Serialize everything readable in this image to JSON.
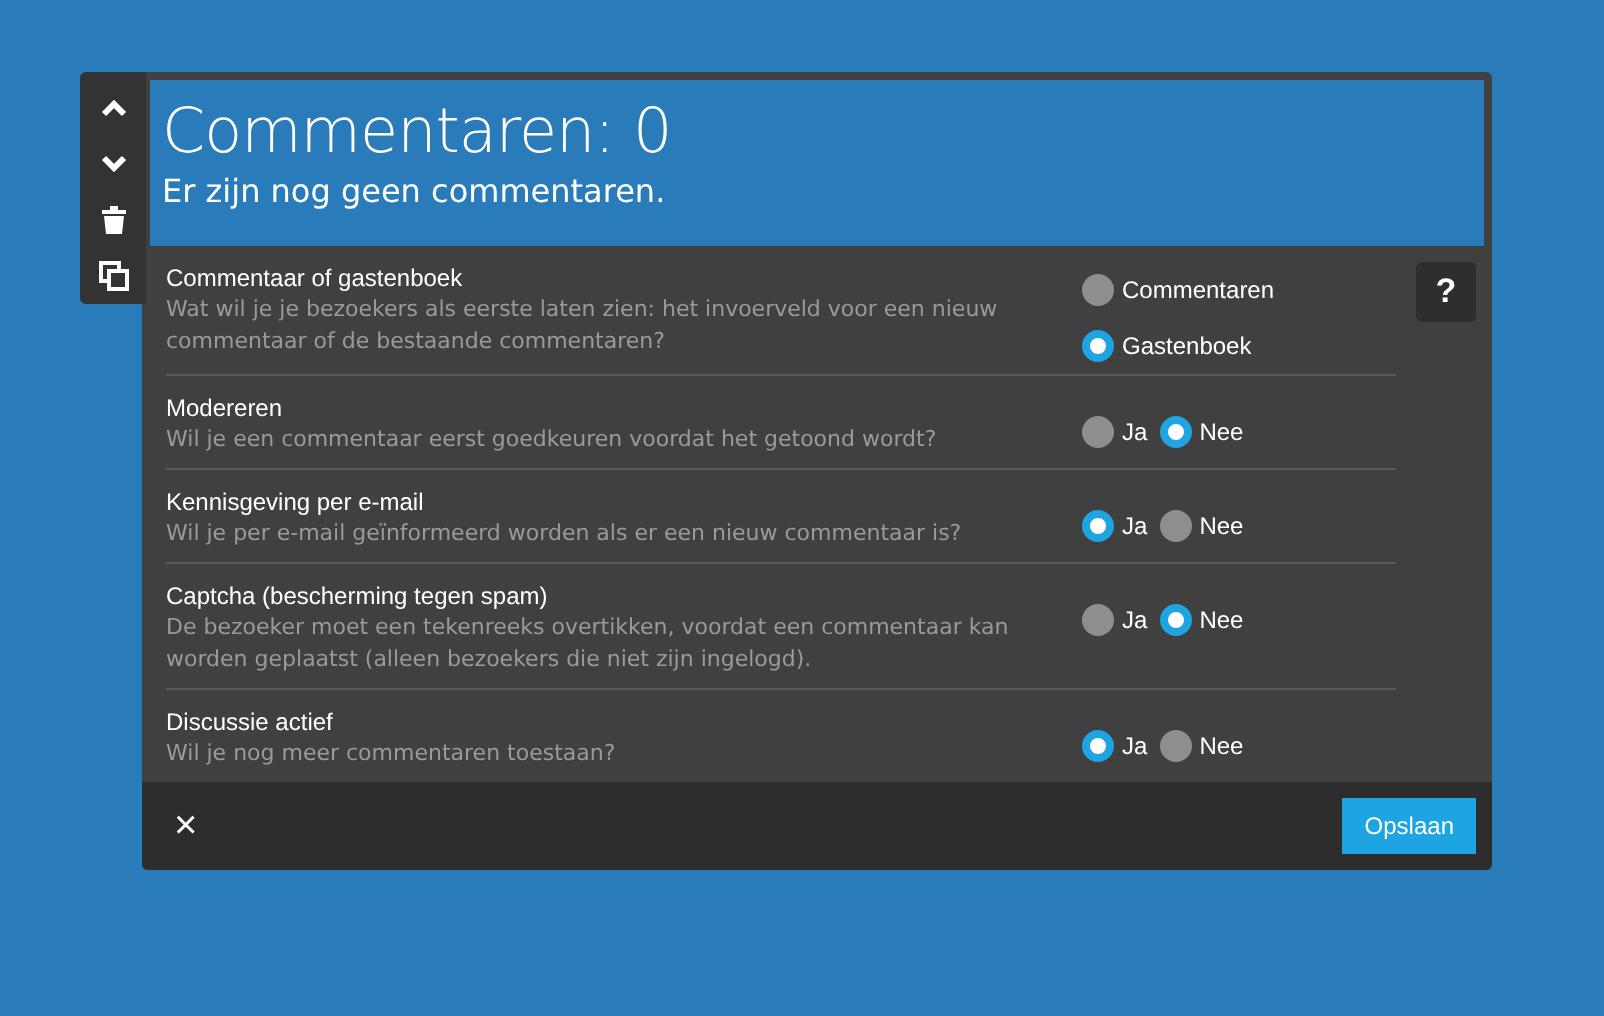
{
  "toolbar": {
    "buttons": [
      {
        "kind": "up"
      },
      {
        "kind": "down"
      },
      {
        "kind": "delete"
      },
      {
        "kind": "copy"
      }
    ]
  },
  "header": {
    "title": "Commentaren: 0",
    "subtitle": "Er zijn nog geen commentaren."
  },
  "help_button": "?",
  "settings": [
    {
      "title": "Commentaar of gastenboek",
      "description": "Wat wil je je bezoekers als eerste laten zien: het invoerveld voor een nieuw commentaar of de bestaande commentaren?",
      "kind": "stacked",
      "options": [
        {
          "label": "Commentaren",
          "selected": false
        },
        {
          "label": "Gastenboek",
          "selected": true
        }
      ]
    },
    {
      "title": "Modereren",
      "description": "Wil je een commentaar eerst goedkeuren voordat het getoond wordt?",
      "kind": "inline",
      "options": [
        {
          "label": "Ja",
          "selected": false
        },
        {
          "label": "Nee",
          "selected": true
        }
      ]
    },
    {
      "title": "Kennisgeving per e-mail",
      "description": "Wil je per e-mail geïnformeerd worden als er een nieuw commentaar is?",
      "kind": "inline",
      "options": [
        {
          "label": "Ja",
          "selected": true
        },
        {
          "label": "Nee",
          "selected": false
        }
      ]
    },
    {
      "title": "Captcha (bescherming tegen spam)",
      "description": "De bezoeker moet een tekenreeks overtikken, voordat een commentaar kan worden geplaatst (alleen bezoekers die niet zijn ingelogd).",
      "kind": "inline",
      "options": [
        {
          "label": "Ja",
          "selected": false
        },
        {
          "label": "Nee",
          "selected": true
        }
      ]
    },
    {
      "title": "Discussie actief",
      "description": "Wil je nog meer commentaren toestaan?",
      "kind": "inline",
      "options": [
        {
          "label": "Ja",
          "selected": true
        },
        {
          "label": "Nee",
          "selected": false
        }
      ]
    }
  ],
  "footer": {
    "close": "×",
    "save": "Opslaan"
  }
}
